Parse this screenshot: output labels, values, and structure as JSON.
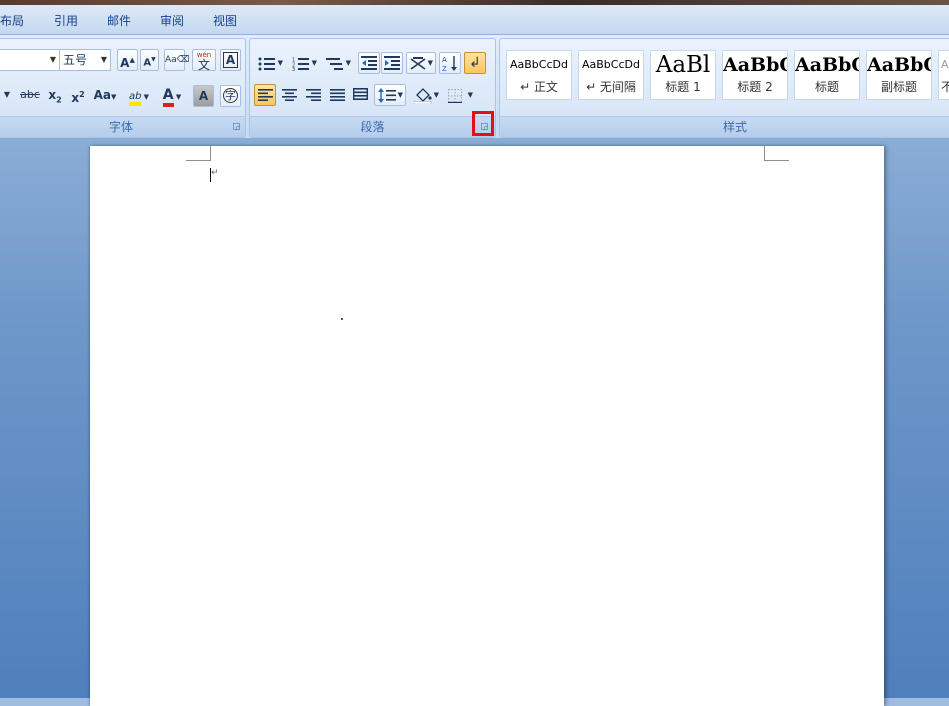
{
  "tabs": [
    "布局",
    "引用",
    "邮件",
    "审阅",
    "视图"
  ],
  "font_group": {
    "label": "字体",
    "font_size": "五号",
    "grow_font": "A",
    "shrink_font": "A",
    "strike": "abc",
    "subscript": "x",
    "superscript": "x",
    "change_case": "Aa",
    "font_color_letter": "A",
    "char_shading_letter": "A",
    "enclose_char": "字",
    "phonetic": "wén",
    "phonetic_char": "文",
    "char_border": "A",
    "highlight_letters": "ab"
  },
  "paragraph_group": {
    "label": "段落"
  },
  "styles_group": {
    "label": "样式",
    "items": [
      {
        "sample": "AaBbCcDd",
        "name": "↵ 正文"
      },
      {
        "sample": "AaBbCcDd",
        "name": "↵ 无间隔"
      },
      {
        "sample": "AaBl",
        "name": "标题 1"
      },
      {
        "sample": "AaBbC",
        "name": "标题 2"
      },
      {
        "sample": "AaBbC",
        "name": "标题"
      },
      {
        "sample": "AaBbC",
        "name": "副标题"
      },
      {
        "sample": "A",
        "name": "不"
      }
    ]
  },
  "colors": {
    "highlight": "#f5e600",
    "font_color": "#e0201e",
    "active_button": "#ffc65a",
    "red_box": "#e3101a"
  }
}
